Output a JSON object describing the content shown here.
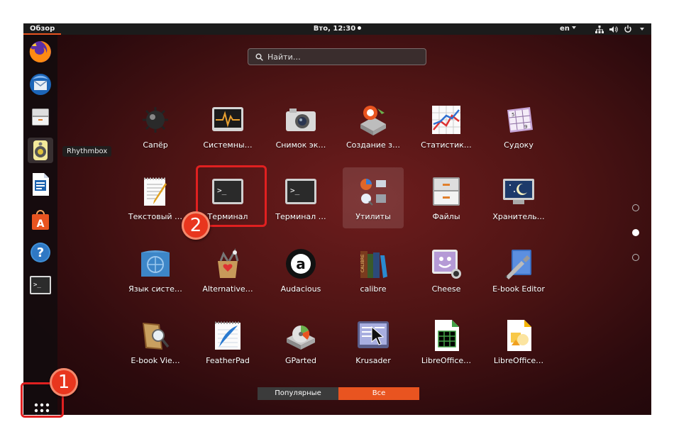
{
  "topbar": {
    "overview": "Обзор",
    "clock": "Вто, 12:30",
    "lang": "en"
  },
  "search": {
    "placeholder": "Найти…"
  },
  "tooltip": "Rhythmbox",
  "dock": {
    "items": [
      "firefox-icon",
      "thunderbird-icon",
      "files-cabinet-icon",
      "rhythmbox-icon",
      "writer-icon",
      "software-store-icon",
      "help-icon",
      "terminal-icon"
    ]
  },
  "apps": [
    {
      "label": "Сапёр",
      "icon": "mine-icon"
    },
    {
      "label": "Системны…",
      "icon": "system-monitor-icon"
    },
    {
      "label": "Снимок эк…",
      "icon": "camera-icon"
    },
    {
      "label": "Создание з…",
      "icon": "usb-creator-icon"
    },
    {
      "label": "Статистик…",
      "icon": "statistics-icon"
    },
    {
      "label": "Судоку",
      "icon": "sudoku-icon"
    },
    {
      "label": "Текстовый …",
      "icon": "text-editor-icon"
    },
    {
      "label": "Терминал",
      "icon": "terminal-icon"
    },
    {
      "label": "Терминал …",
      "icon": "terminal-icon"
    },
    {
      "label": "Утилиты",
      "icon": "utilities-folder-icon"
    },
    {
      "label": "Файлы",
      "icon": "files-icon"
    },
    {
      "label": "Хранитель…",
      "icon": "screensaver-icon"
    },
    {
      "label": "Язык систе…",
      "icon": "language-icon"
    },
    {
      "label": "Alternative…",
      "icon": "alternative-icon"
    },
    {
      "label": "Audacious",
      "icon": "audacious-icon"
    },
    {
      "label": "calibre",
      "icon": "calibre-icon"
    },
    {
      "label": "Cheese",
      "icon": "cheese-icon"
    },
    {
      "label": "E-book Editor",
      "icon": "ebook-editor-icon"
    },
    {
      "label": "E-book Vie…",
      "icon": "ebook-viewer-icon"
    },
    {
      "label": "FeatherPad",
      "icon": "featherpad-icon"
    },
    {
      "label": "GParted",
      "icon": "gparted-icon"
    },
    {
      "label": "Krusader",
      "icon": "krusader-icon"
    },
    {
      "label": "LibreOffice…",
      "icon": "libreoffice-calc-icon"
    },
    {
      "label": "LibreOffice…",
      "icon": "libreoffice-draw-icon"
    }
  ],
  "tabs": {
    "frequent": "Популярные",
    "all": "Все"
  },
  "annotations": {
    "badge1": "1",
    "badge2": "2"
  },
  "colors": {
    "accent": "#e95420",
    "highlight": "#e02020"
  }
}
